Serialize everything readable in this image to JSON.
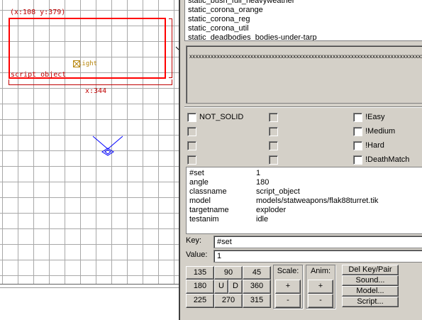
{
  "viewport": {
    "coord_readout": "(x:108  y:379)",
    "width_readout": "x:344",
    "entity_label": "script_object",
    "light_label": "light",
    "colors": {
      "grid": "#a8a8a8",
      "selection": "#ff0000",
      "light": "#b8860b",
      "camera": "#0000ff"
    },
    "icons": [
      "light-entity-icon",
      "camera-icon"
    ]
  },
  "class_list": [
    "static_bush_full_heavyweather",
    "static_corona_orange",
    "static_corona_reg",
    "static_corona_util",
    "static_deadbodies_bodies-under-tarp"
  ],
  "comment": "xxxxxxxxxxxxxxxxxxxxxxxxxxxxxxxxxxxxxxxxxxxxxxxxxxxxxxxxxxxxxxxxxxxxxxxxxxxxxxxxxxxxxxx",
  "spawnflags": {
    "col1": [
      "NOT_SOLID",
      "",
      "",
      ""
    ],
    "col3": [
      "!Easy",
      "!Medium",
      "!Hard",
      "!DeathMatch"
    ]
  },
  "keyvalues": [
    {
      "key": "#set",
      "value": "1"
    },
    {
      "key": "angle",
      "value": "180"
    },
    {
      "key": "classname",
      "value": "script_object"
    },
    {
      "key": "model",
      "value": "models/statweapons/flak88turret.tik"
    },
    {
      "key": "targetname",
      "value": "exploder"
    },
    {
      "key": "testanim",
      "value": "idle"
    }
  ],
  "key_field": {
    "label": "Key:",
    "value": "#set"
  },
  "value_field": {
    "label": "Value:",
    "value": "1"
  },
  "angle_buttons": {
    "b135": "135",
    "b90": "90",
    "b45": "45",
    "b180": "180",
    "up": "U",
    "down": "D",
    "b360": "360",
    "b225": "225",
    "b270": "270",
    "b315": "315"
  },
  "scale": {
    "label": "Scale:",
    "plus": "+",
    "minus": "-"
  },
  "anim": {
    "label": "Anim:",
    "plus": "+",
    "minus": "-"
  },
  "actions": {
    "del_key_pair": "Del Key/Pair",
    "sound": "Sound...",
    "model": "Model...",
    "script": "Script..."
  }
}
